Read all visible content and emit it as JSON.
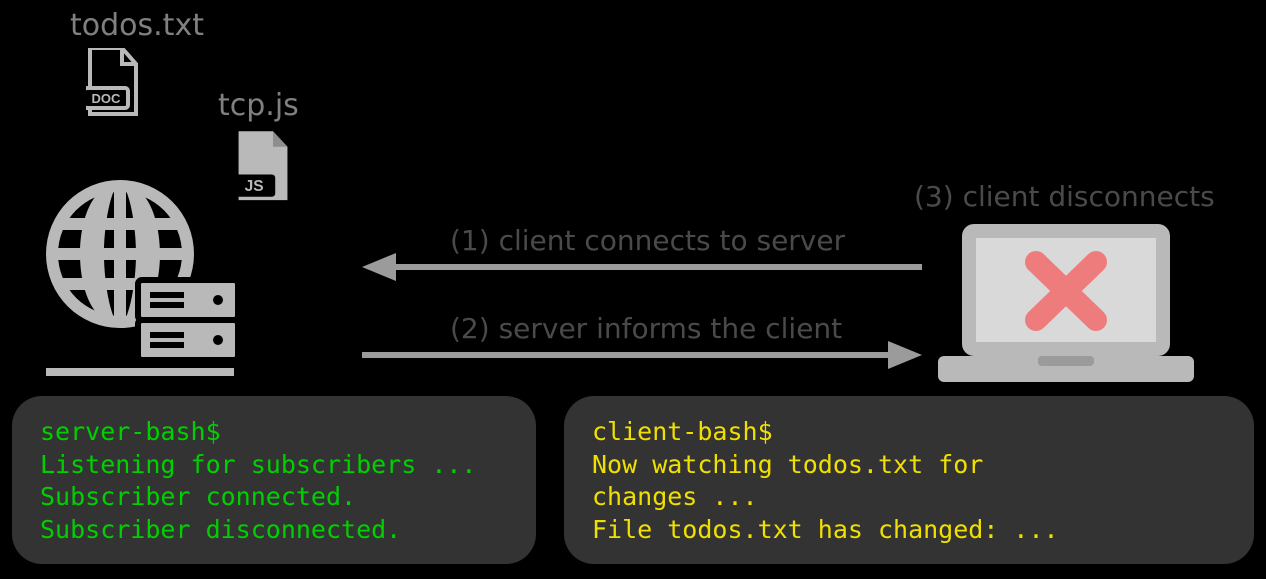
{
  "files": {
    "todos_label": "todos.txt",
    "todos_badge": "DOC",
    "tcp_label": "tcp.js",
    "tcp_badge": "JS"
  },
  "steps": {
    "s1": "(1) client connects to server",
    "s2": "(2) server informs the client",
    "s3": "(3) client disconnects"
  },
  "terminals": {
    "server": "server-bash$\nListening for subscribers ...\nSubscriber connected.\nSubscriber disconnected.",
    "client": "client-bash$\nNow watching todos.txt for\nchanges ...\nFile todos.txt has changed: ..."
  },
  "colors": {
    "icon_grey": "#b9b9b9",
    "arrow_grey": "#9b9b9b",
    "text_grey": "#808080",
    "caption_grey": "#4a4a4a",
    "term_bg": "#333333",
    "term_green": "#00d000",
    "term_yellow": "#f0e000",
    "cross_red": "#ee7c7c"
  }
}
